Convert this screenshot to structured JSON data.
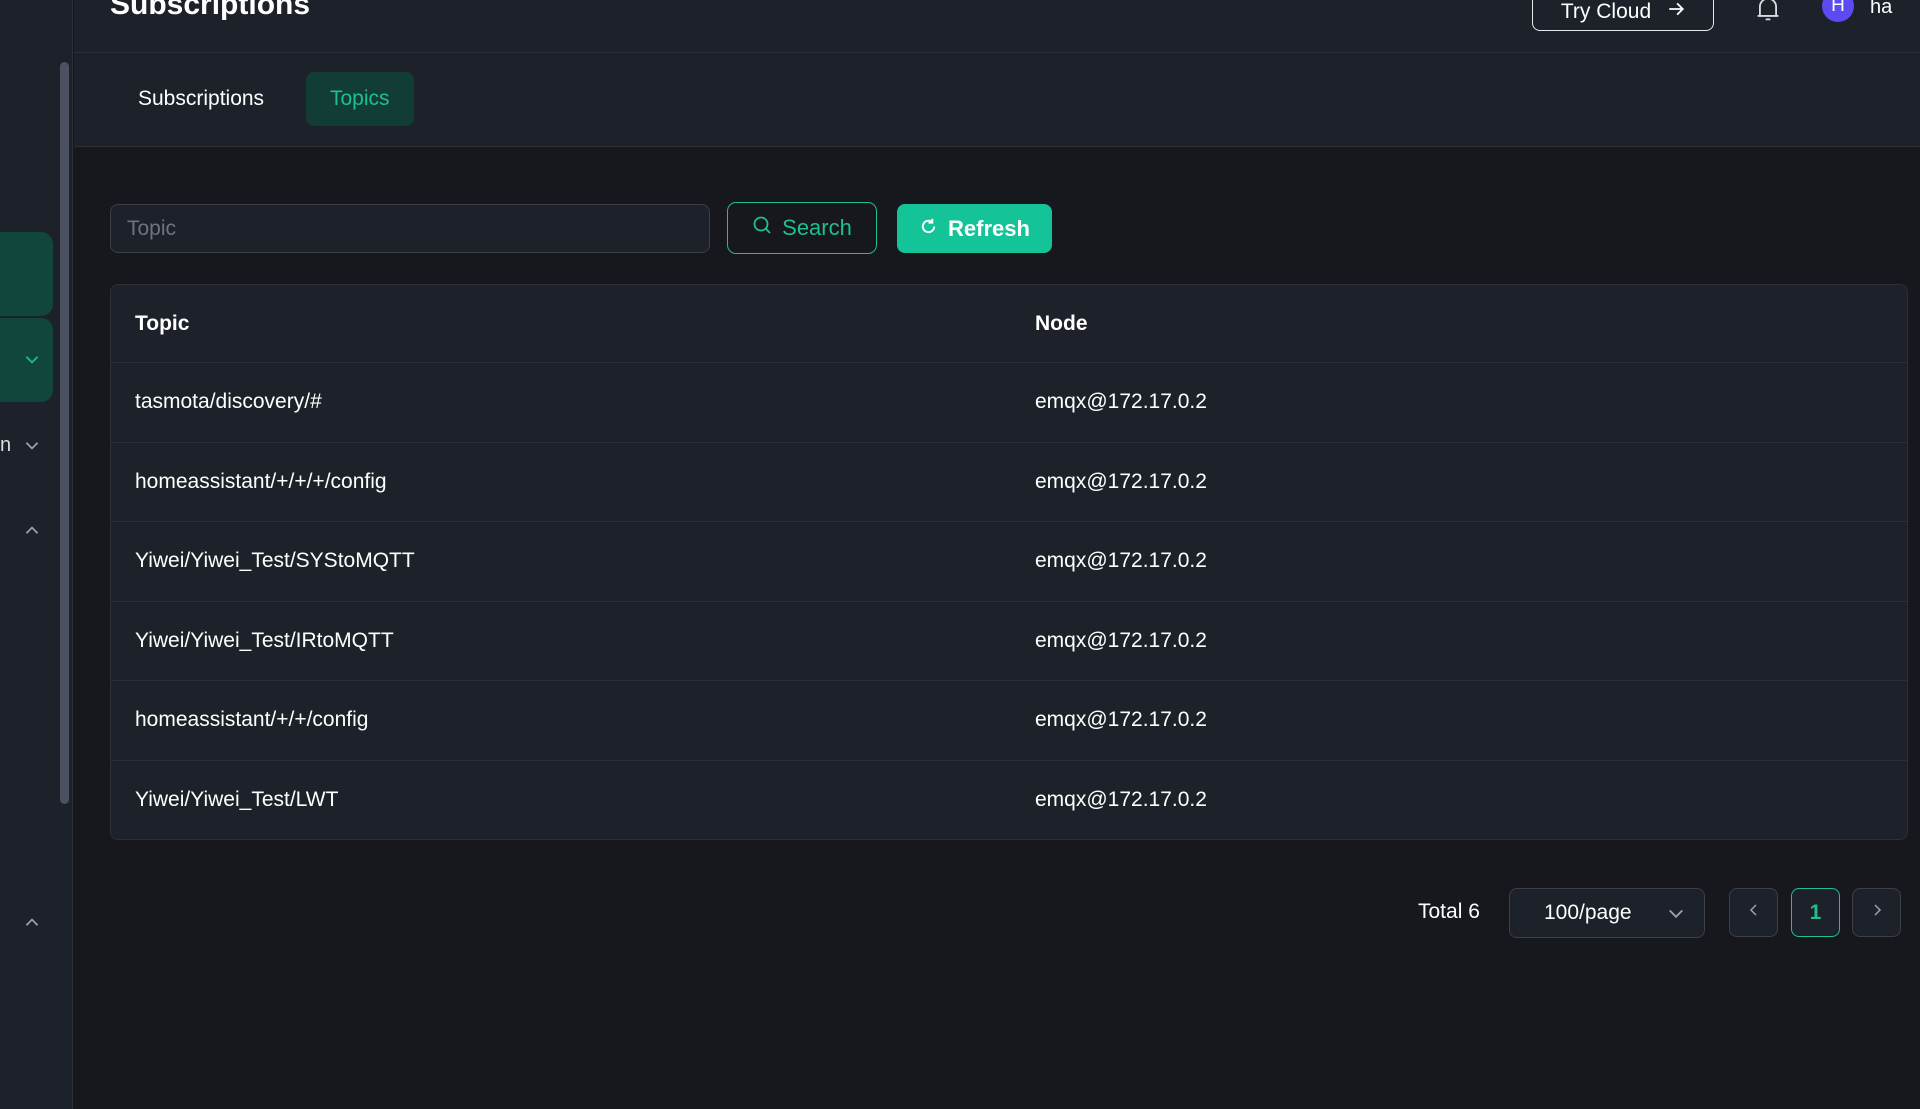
{
  "header": {
    "title": "Subscriptions",
    "try_cloud_label": "Try Cloud",
    "avatar_initial": "H",
    "username": "ha"
  },
  "sidebar": {
    "partial_text": "n"
  },
  "tabs": [
    {
      "label": "Subscriptions",
      "active": false
    },
    {
      "label": "Topics",
      "active": true
    }
  ],
  "toolbar": {
    "topic_placeholder": "Topic",
    "topic_value": "",
    "search_label": "Search",
    "refresh_label": "Refresh"
  },
  "table": {
    "columns": [
      "Topic",
      "Node"
    ],
    "rows": [
      {
        "topic": "tasmota/discovery/#",
        "node": "emqx@172.17.0.2"
      },
      {
        "topic": "homeassistant/+/+/+/config",
        "node": "emqx@172.17.0.2"
      },
      {
        "topic": "Yiwei/Yiwei_Test/SYStoMQTT",
        "node": "emqx@172.17.0.2"
      },
      {
        "topic": "Yiwei/Yiwei_Test/IRtoMQTT",
        "node": "emqx@172.17.0.2"
      },
      {
        "topic": "homeassistant/+/+/config",
        "node": "emqx@172.17.0.2"
      },
      {
        "topic": "Yiwei/Yiwei_Test/LWT",
        "node": "emqx@172.17.0.2"
      }
    ]
  },
  "pagination": {
    "total_label": "Total 6",
    "page_size": "100/page",
    "current_page": "1"
  },
  "colors": {
    "accent": "#1fbf8f",
    "accent_button": "#15c399",
    "background": "#16181d",
    "panel": "#1d2129",
    "avatar": "#5b4bf0"
  }
}
